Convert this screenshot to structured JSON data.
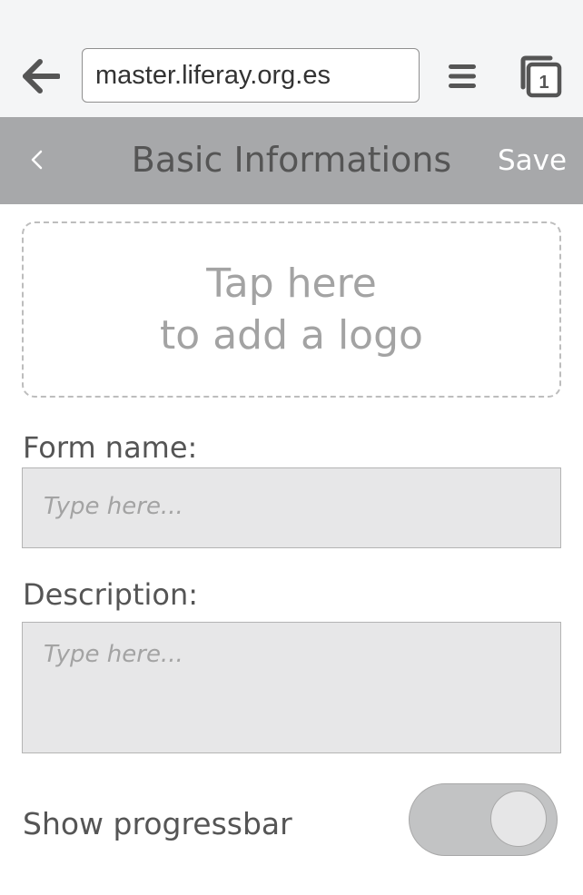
{
  "browser": {
    "url": "master.liferay.org.es",
    "tab_count": "1",
    "icons": [
      "back-arrow-icon",
      "hamburger-menu-icon",
      "tabs-icon"
    ]
  },
  "header": {
    "title": "Basic Informations",
    "save_label": "Save",
    "back_icon": "chevron-left-icon"
  },
  "logo_upload": {
    "line1": "Tap here",
    "line2": "to add a logo"
  },
  "form": {
    "name_label": "Form name:",
    "name_placeholder": "Type here...",
    "description_label": "Description:",
    "description_placeholder": "Type here...",
    "progressbar_label": "Show progressbar",
    "progressbar_enabled": true
  },
  "colors": {
    "header_bg": "#a7a8aa",
    "field_bg": "#e7e7e8",
    "toggle_bg": "#c2c3c4"
  }
}
